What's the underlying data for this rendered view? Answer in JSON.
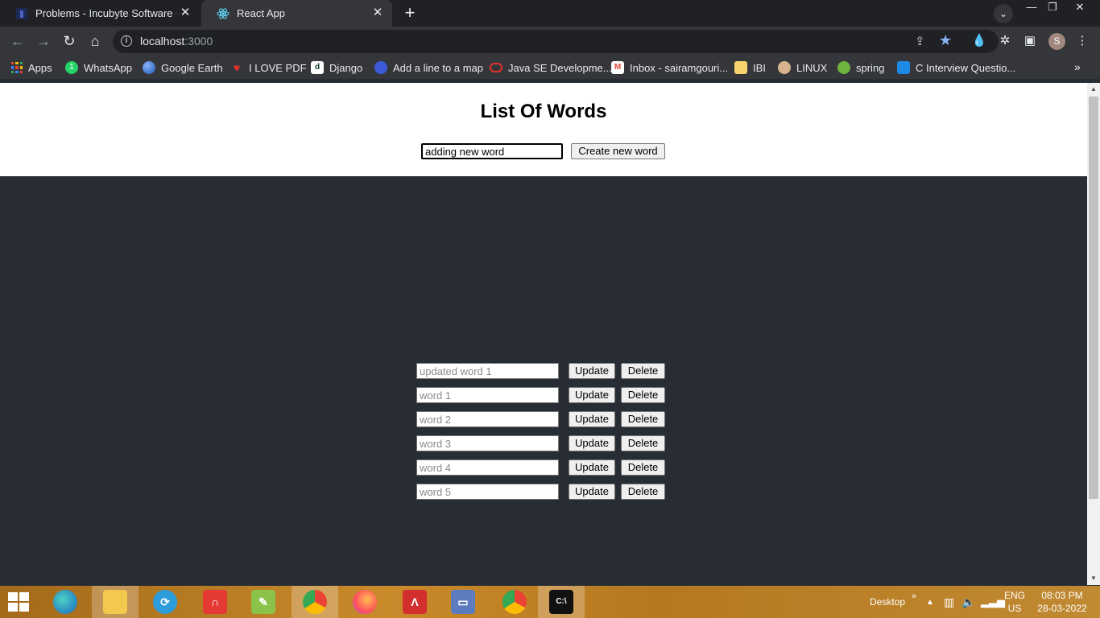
{
  "browser": {
    "tabs": [
      {
        "title": "Problems - Incubyte Software Cr",
        "icon": "incubyte-favicon",
        "active": false
      },
      {
        "title": "React App",
        "icon": "react-favicon",
        "active": true
      }
    ],
    "new_tab": "+",
    "window_controls": {
      "minimize": "—",
      "restore": "❐",
      "close": "✕"
    },
    "tab_search": "⌄",
    "nav": {
      "back": "←",
      "forward": "→",
      "reload": "↻",
      "home": "⌂"
    },
    "url": {
      "host": "localhost",
      "port": ":3000"
    },
    "avatar_letter": "S",
    "bookmarks": [
      {
        "label": "Apps",
        "icon": "apps-grid-icon"
      },
      {
        "label": "WhatsApp",
        "icon": "whatsapp-icon"
      },
      {
        "label": "Google Earth",
        "icon": "google-earth-icon"
      },
      {
        "label": "I LOVE PDF",
        "icon": "ilovepdf-icon"
      },
      {
        "label": "Django",
        "icon": "django-icon"
      },
      {
        "label": "Add a line to a map",
        "icon": "map-icon"
      },
      {
        "label": "Java SE Developme...",
        "icon": "oracle-icon"
      },
      {
        "label": "Inbox - sairamgouri...",
        "icon": "gmail-icon"
      },
      {
        "label": "IBI",
        "icon": "folder-icon"
      },
      {
        "label": "LINUX",
        "icon": "linux-icon"
      },
      {
        "label": "spring",
        "icon": "spring-icon"
      },
      {
        "label": "C Interview Questio...",
        "icon": "grid-site-icon"
      }
    ],
    "bookmarks_more": "»"
  },
  "app": {
    "title": "List Of Words",
    "new_word_value": "adding new word",
    "create_label": "Create new word",
    "words": [
      {
        "placeholder": "updated word 1",
        "update_label": "Update",
        "delete_label": "Delete"
      },
      {
        "placeholder": "word 1",
        "update_label": "Update",
        "delete_label": "Delete"
      },
      {
        "placeholder": "word 2",
        "update_label": "Update",
        "delete_label": "Delete"
      },
      {
        "placeholder": "word 3",
        "update_label": "Update",
        "delete_label": "Delete"
      },
      {
        "placeholder": "word 4",
        "update_label": "Update",
        "delete_label": "Delete"
      },
      {
        "placeholder": "word 5",
        "update_label": "Update",
        "delete_label": "Delete"
      }
    ]
  },
  "taskbar": {
    "apps": [
      "edge",
      "file-explorer",
      "sync-app",
      "headphones-app",
      "notepad-plus-plus",
      "chrome-profile",
      "firefox",
      "acrobat",
      "remote-desktop",
      "chrome",
      "command-prompt"
    ],
    "desktop_label": "Desktop",
    "desktop_chevron": "»",
    "lang_top": "ENG",
    "lang_bottom": "US",
    "time": "08:03 PM",
    "date": "28-03-2022"
  },
  "colors": {
    "page_bg": "#282c34",
    "header_bg": "#ffffff",
    "chrome_dark": "#202124",
    "chrome_toolbar": "#35363a",
    "accent_star": "#8ab4f8"
  }
}
